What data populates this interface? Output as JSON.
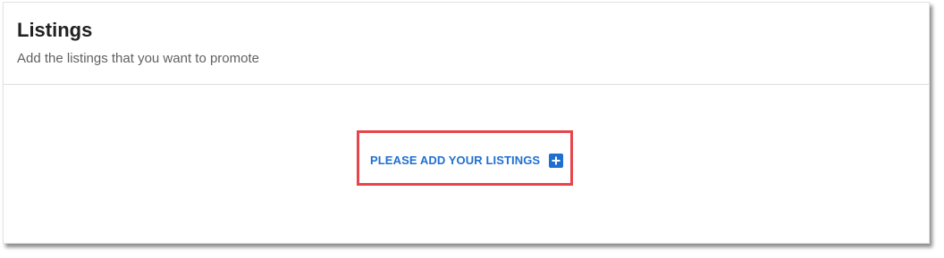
{
  "listings": {
    "title": "Listings",
    "subtitle": "Add the listings that you want to promote",
    "add_button_label": "PLEASE ADD YOUR LISTINGS",
    "add_icon": "plus-square-icon",
    "accent_color": "#1f6fd1",
    "highlight_color": "#e8454b"
  }
}
